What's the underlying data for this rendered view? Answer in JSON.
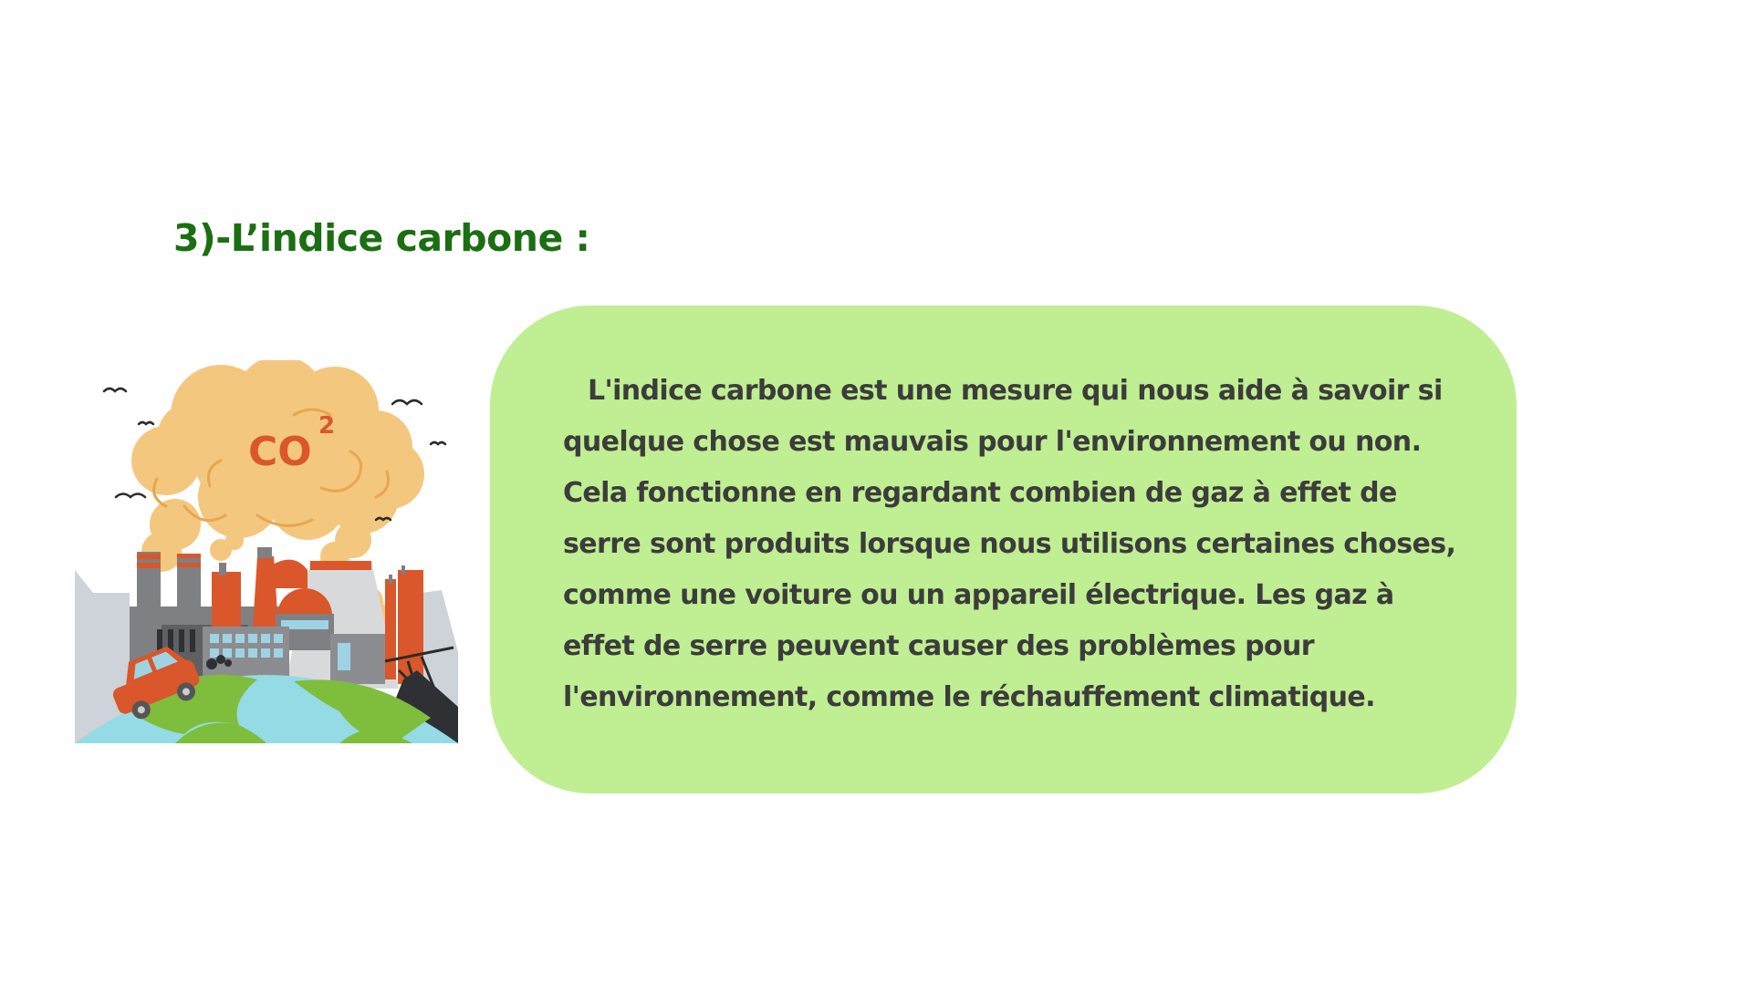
{
  "heading": "3)-L’indice carbone :",
  "illustration": {
    "icon": "factory-pollution-co2-icon",
    "label_main": "CO",
    "label_superscript": "2",
    "colors": {
      "smoke": "#f4c77e",
      "co2_text": "#d9572a",
      "earth_water": "#94dbe6",
      "earth_land": "#7fbd3c",
      "buildings_gray": "#7f8083",
      "buildings_orange": "#d9572a"
    }
  },
  "text_box": {
    "background": "#c0ee92",
    "paragraph": "L'indice carbone est une mesure qui nous aide à savoir si quelque chose est mauvais pour l'environnement ou non. Cela fonctionne en regardant combien de gaz à effet de serre sont produits lorsque nous utilisons certaines choses, comme une voiture ou un appareil électrique. Les gaz à effet de serre peuvent causer des problèmes pour l'environnement, comme le réchauffement climatique."
  },
  "colors": {
    "heading": "#1b6e12",
    "body_text": "#3c3c3c",
    "background": "#ffffff"
  }
}
